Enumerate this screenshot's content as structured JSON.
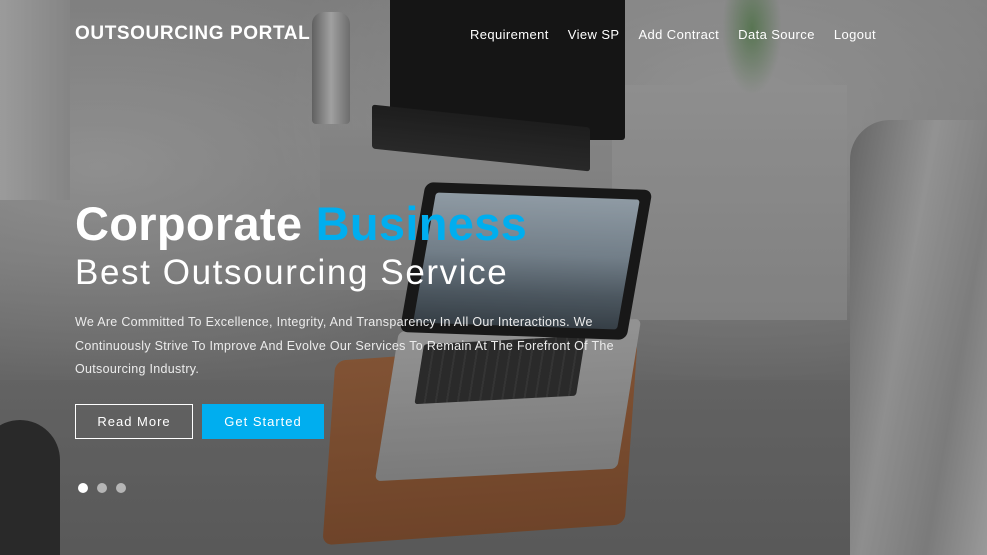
{
  "brand": {
    "name": "OUTSOURCING PORTAL"
  },
  "nav": {
    "items": [
      {
        "label": "Requirement"
      },
      {
        "label": "View SP"
      },
      {
        "label": "Add Contract"
      },
      {
        "label": "Data Source"
      },
      {
        "label": "Logout"
      }
    ]
  },
  "hero": {
    "headline_main": "Corporate",
    "headline_accent": "Business",
    "subheadline": "Best Outsourcing Service",
    "description": "We Are Committed To Excellence, Integrity, And Transparency In All Our Interactions. We Continuously Strive To Improve And Evolve Our Services To Remain At The Forefront Of The Outsourcing Industry.",
    "read_more_label": "Read More",
    "get_started_label": "Get Started"
  },
  "carousel": {
    "slide_count": 3,
    "active_index": 0
  },
  "colors": {
    "accent": "#00aeef",
    "text": "#ffffff"
  }
}
